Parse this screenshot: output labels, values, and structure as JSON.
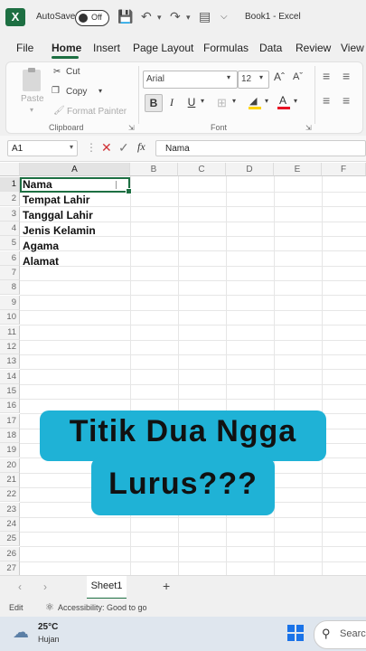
{
  "titlebar": {
    "autosave_label": "AutoSave",
    "toggle_label": "Off",
    "title": "Book1  -  Excel"
  },
  "tabs": [
    "File",
    "Home",
    "Insert",
    "Page Layout",
    "Formulas",
    "Data",
    "Review",
    "View"
  ],
  "ribbon": {
    "clipboard": {
      "paste": "Paste",
      "cut": "Cut",
      "copy": "Copy",
      "format_painter": "Format Painter",
      "label": "Clipboard"
    },
    "font": {
      "name": "Arial",
      "size": "12",
      "label": "Font",
      "bold": "B",
      "italic": "I",
      "underline": "U",
      "font_color_letter": "A"
    }
  },
  "formula_bar": {
    "name_box": "A1",
    "fx": "fx",
    "value": "Nama"
  },
  "grid": {
    "columns": [
      "A",
      "B",
      "C",
      "D",
      "E",
      "F"
    ],
    "rows": [
      "1",
      "2",
      "3",
      "4",
      "5",
      "6",
      "7",
      "8",
      "9",
      "10",
      "11",
      "12",
      "13",
      "14",
      "15",
      "16",
      "17",
      "18",
      "19",
      "20",
      "21",
      "22",
      "23",
      "24",
      "25",
      "26",
      "27"
    ],
    "cells_A": [
      "Nama",
      "Tempat Lahir",
      "Tanggal Lahir",
      "Jenis Kelamin",
      "Agama",
      "Alamat"
    ]
  },
  "caption": {
    "line1": "Titik Dua Ngga",
    "line2": "Lurus???"
  },
  "sheets": {
    "active": "Sheet1",
    "add": "+"
  },
  "statusbar": {
    "mode": "Edit",
    "accessibility": "Accessibility: Good to go"
  },
  "taskbar": {
    "temp": "25°C",
    "weather": "Hujan",
    "search": "Searc"
  },
  "colors": {
    "excel_green": "#1d6f42",
    "caption_bg": "#1fb2d6"
  }
}
